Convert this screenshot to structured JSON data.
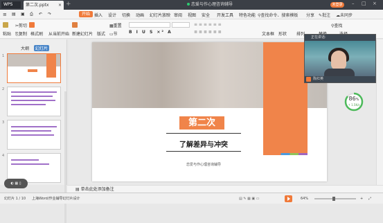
{
  "titlebar": {
    "app": "WPS",
    "tab": "第二次.pptx",
    "meeting": "恋爱与作心理咨询辅导",
    "login": "未登录"
  },
  "menu": {
    "items": [
      "开始",
      "插入",
      "设计",
      "切换",
      "动画",
      "幻灯片放映",
      "审阅",
      "视图",
      "安全",
      "开发工具",
      "特色功能"
    ],
    "active": "开始",
    "search": "查找命令、搜索模板",
    "share": "分享",
    "comment": "批注",
    "cloud": "未同步"
  },
  "toolbar": {
    "paste": "粘贴",
    "cut": "剪切",
    "copy": "复制",
    "format_painter": "格式刷",
    "from_current": "从当前开始",
    "new_slide": "新建幻灯片",
    "layout": "版式",
    "reset": "重置",
    "section": "节",
    "text_box": "文本框",
    "shape": "形状",
    "arrange": "排列",
    "find": "查找",
    "replace": "替换",
    "select": "选择"
  },
  "sidebar": {
    "tab_outline": "大纲",
    "tab_slides": "幻灯片",
    "thumb_numbers": [
      "1",
      "2",
      "3",
      "4"
    ]
  },
  "slide": {
    "badge": "第二次",
    "subtitle": "了解差异与冲突",
    "footer": "恋爱与作心理咨询辅导"
  },
  "video": {
    "header": "正在讲话:",
    "name": "陈红英"
  },
  "progress": {
    "percent": "86",
    "unit": "%",
    "speed": "↑ 1.5K/s"
  },
  "notes": {
    "placeholder": "单击此处添加备注"
  },
  "status": {
    "slide_info": "幻灯片 1 / 10",
    "theme": "上海Word/作业辅导幻灯片设计",
    "zoom": "64%"
  },
  "colors": {
    "accent": "#f07a3a",
    "titlebar": "#3b3f46",
    "link": "#4a86c8"
  }
}
